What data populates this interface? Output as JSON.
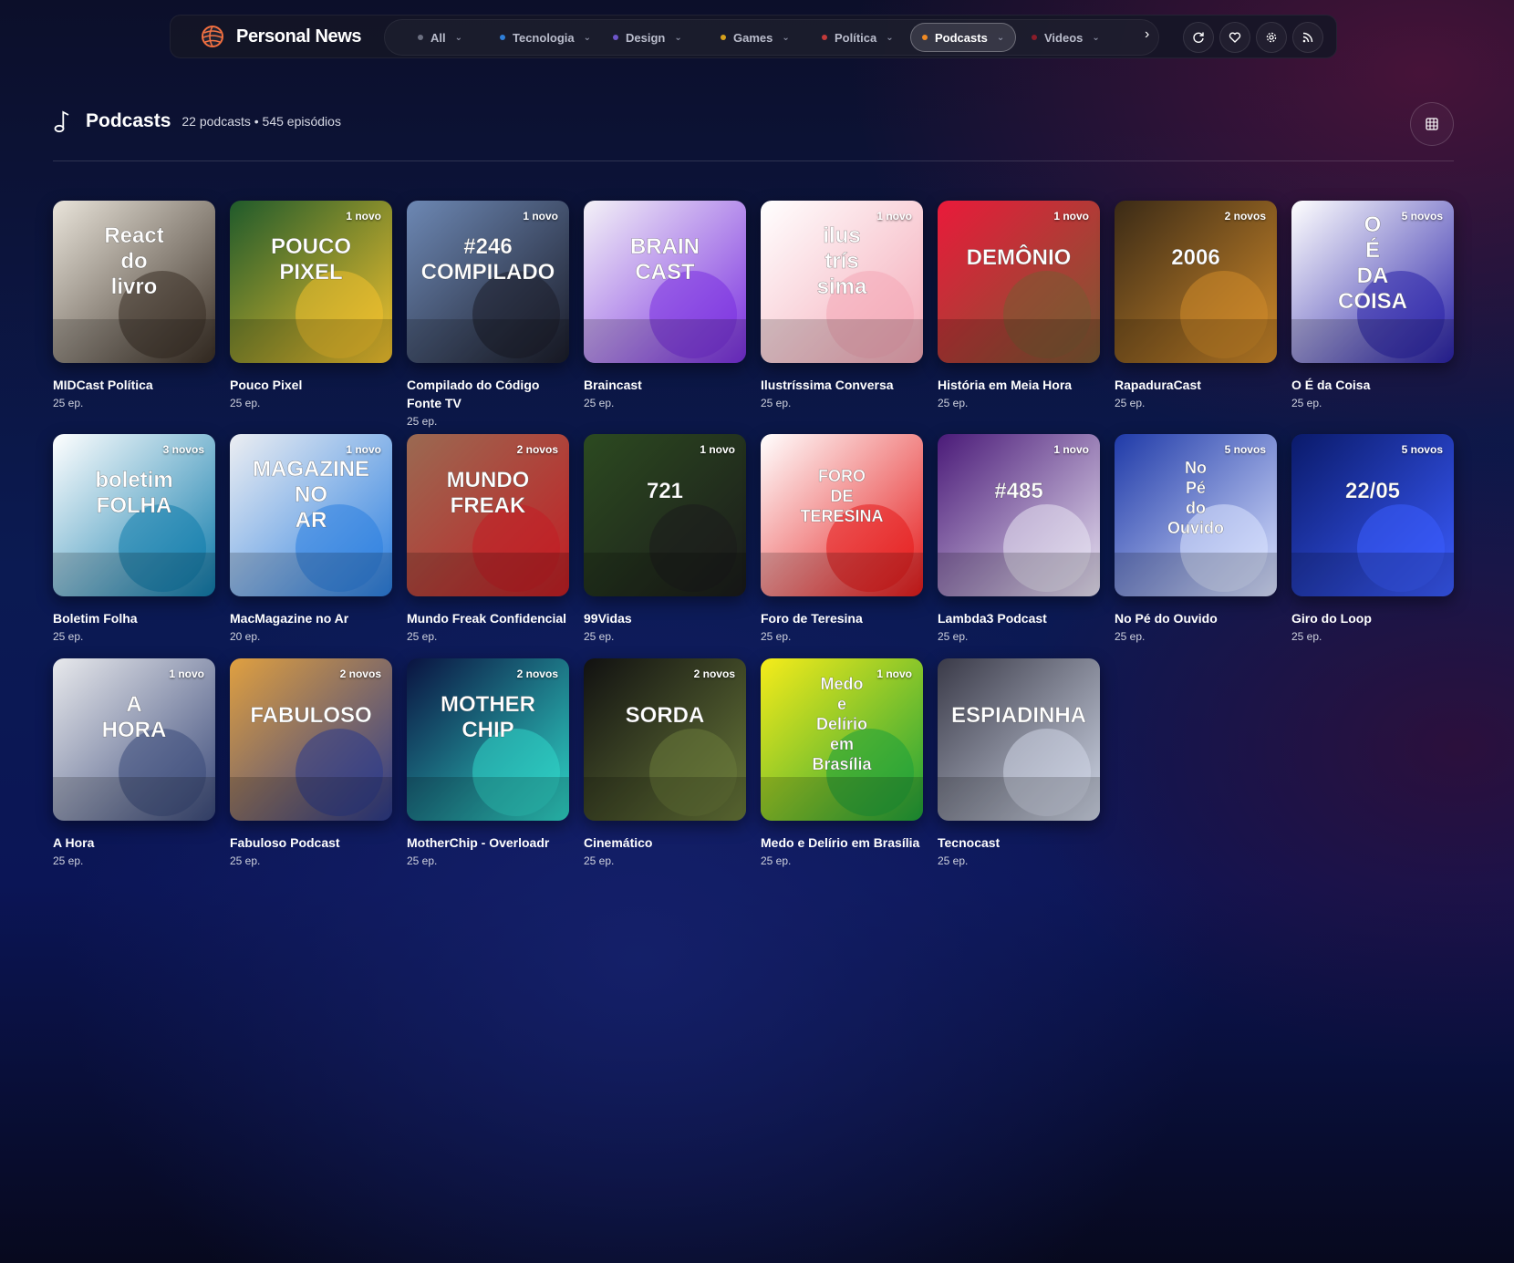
{
  "app": {
    "name": "Personal News"
  },
  "nav": {
    "tabs": [
      {
        "label": "All",
        "dot": "#6b6f80",
        "active": false
      },
      {
        "label": "Tecnologia",
        "dot": "#2f7fd9",
        "active": false
      },
      {
        "label": "Design",
        "dot": "#6d55c9",
        "active": false
      },
      {
        "label": "Games",
        "dot": "#d6a11c",
        "active": false
      },
      {
        "label": "Política",
        "dot": "#c23a3a",
        "active": false
      },
      {
        "label": "Podcasts",
        "dot": "#f08a24",
        "active": true
      },
      {
        "label": "Videos",
        "dot": "#8a1d2a",
        "active": false
      }
    ]
  },
  "header": {
    "title": "Podcasts",
    "subtitle": "22 podcasts • 545 episódios"
  },
  "podcasts": [
    {
      "title": "MIDCast Política",
      "eps": "25 ep.",
      "badge": "",
      "cover": "React do livro",
      "colors": [
        "#e9e4da",
        "#3b3026"
      ]
    },
    {
      "title": "Pouco Pixel",
      "eps": "25 ep.",
      "badge": "1 novo",
      "cover": "POUCO PIXEL",
      "colors": [
        "#1f5a2b",
        "#f2c12e"
      ]
    },
    {
      "title": "Compilado do Código Fonte TV",
      "eps": "25 ep.",
      "badge": "1 novo",
      "cover": "#246 COMPILADO",
      "colors": [
        "#6d88b4",
        "#1b1d2a"
      ]
    },
    {
      "title": "Braincast",
      "eps": "25 ep.",
      "badge": "",
      "cover": "BRAIN CAST",
      "colors": [
        "#f4f2f7",
        "#7a2fe0"
      ]
    },
    {
      "title": "Ilustríssima Conversa",
      "eps": "25 ep.",
      "badge": "1 novo",
      "cover": "ilus trís sima",
      "colors": [
        "#ffffff",
        "#f4a8b6"
      ]
    },
    {
      "title": "História em Meia Hora",
      "eps": "25 ep.",
      "badge": "1 novo",
      "cover": "DEMÔNIO",
      "colors": [
        "#ea1a3a",
        "#7a5a32"
      ]
    },
    {
      "title": "RapaduraCast",
      "eps": "25 ep.",
      "badge": "2 novos",
      "cover": "2006",
      "colors": [
        "#3a2a16",
        "#d08a2a"
      ]
    },
    {
      "title": "O É da Coisa",
      "eps": "25 ep.",
      "badge": "5 novos",
      "cover": "O É DA COISA",
      "colors": [
        "#ffffff",
        "#2a22a8"
      ]
    },
    {
      "title": "Boletim Folha",
      "eps": "25 ep.",
      "badge": "3 novos",
      "cover": "boletim FOLHA",
      "colors": [
        "#ffffff",
        "#0f7bab"
      ]
    },
    {
      "title": "MacMagazine no Ar",
      "eps": "20 ep.",
      "badge": "1 novo",
      "cover": "MAGAZINE NO AR",
      "colors": [
        "#eceef2",
        "#2b7fe0"
      ]
    },
    {
      "title": "Mundo Freak Confidencial",
      "eps": "25 ep.",
      "badge": "2 novos",
      "cover": "MUNDO FREAK",
      "colors": [
        "#9a6a52",
        "#c21e24"
      ]
    },
    {
      "title": "99Vidas",
      "eps": "25 ep.",
      "badge": "1 novo",
      "cover": "721",
      "colors": [
        "#2c4a20",
        "#1b1b1b"
      ]
    },
    {
      "title": "Foro de Teresina",
      "eps": "25 ep.",
      "badge": "",
      "cover": "FORO DE TERESINA",
      "colors": [
        "#ffffff",
        "#e51a1a"
      ]
    },
    {
      "title": "Lambda3 Podcast",
      "eps": "25 ep.",
      "badge": "1 novo",
      "cover": "#485",
      "colors": [
        "#4a1a78",
        "#e8e3f2"
      ]
    },
    {
      "title": "No Pé do Ouvido",
      "eps": "25 ep.",
      "badge": "5 novos",
      "cover": "No Pé do Ouvido",
      "colors": [
        "#1f3aa8",
        "#dbe3ff"
      ]
    },
    {
      "title": "Giro do Loop",
      "eps": "25 ep.",
      "badge": "5 novos",
      "cover": "22/05",
      "colors": [
        "#0a1a6a",
        "#3b5cff"
      ]
    },
    {
      "title": "A Hora",
      "eps": "25 ep.",
      "badge": "1 novo",
      "cover": "A HORA",
      "colors": [
        "#e8e9ec",
        "#3b4a7a"
      ]
    },
    {
      "title": "Fabuloso Podcast",
      "eps": "25 ep.",
      "badge": "2 novos",
      "cover": "FABULOSO",
      "colors": [
        "#e0a040",
        "#2b3a8a"
      ]
    },
    {
      "title": "MotherChip - Overloadr",
      "eps": "25 ep.",
      "badge": "2 novos",
      "cover": "MOTHER CHIP",
      "colors": [
        "#0a1240",
        "#2fd6c8"
      ]
    },
    {
      "title": "Cinemático",
      "eps": "25 ep.",
      "badge": "2 novos",
      "cover": "SORDA",
      "colors": [
        "#111111",
        "#6a7a3a"
      ]
    },
    {
      "title": "Medo e Delírio em Brasília",
      "eps": "25 ep.",
      "badge": "1 novo",
      "cover": "Medo e Delírio em Brasília",
      "colors": [
        "#f6ec1a",
        "#1ea03a"
      ]
    },
    {
      "title": "Tecnocast",
      "eps": "25 ep.",
      "badge": "",
      "cover": "ESPIADINHA",
      "colors": [
        "#3a3a48",
        "#cfd6e6"
      ]
    }
  ]
}
